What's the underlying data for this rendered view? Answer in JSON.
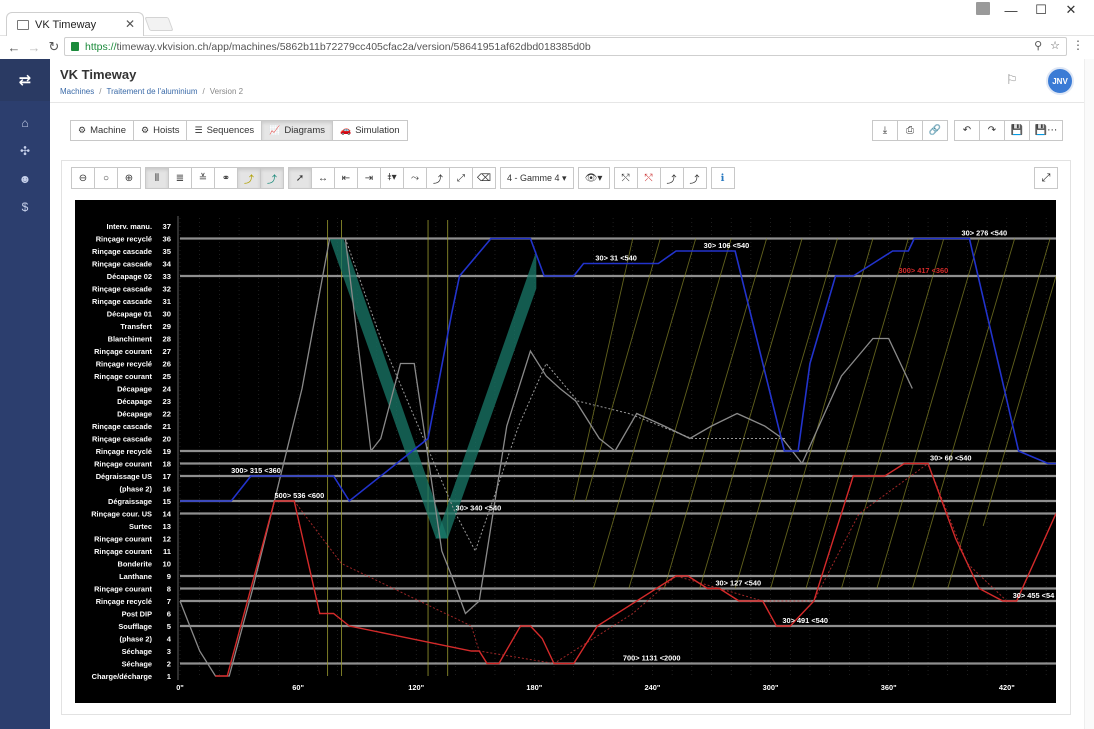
{
  "browser": {
    "tab_title": "VK Timeway",
    "url_scheme": "https://",
    "url_rest": "timeway.vkvision.ch/app/machines/5862b11b72279cc405cfac2a/version/58641951af62dbd018385d0b"
  },
  "app": {
    "title": "VK Timeway",
    "breadcrumb": [
      "Machines",
      "Traitement de l'aluminium",
      "Version 2"
    ],
    "avatar_initials": "JNV"
  },
  "tabs": [
    {
      "label": "Machine",
      "icon": "gear-icon"
    },
    {
      "label": "Hoists",
      "icon": "gear-icon"
    },
    {
      "label": "Sequences",
      "icon": "list-icon"
    },
    {
      "label": "Diagrams",
      "icon": "chart-icon",
      "active": true
    },
    {
      "label": "Simulation",
      "icon": "car-icon"
    }
  ],
  "diagram_toolbar": {
    "gamme_select": "4 - Gamme 4"
  },
  "colors": {
    "sidebar": "#2c3e6e",
    "hoist_blue": "#2233cc",
    "hoist_red": "#d42a2a",
    "hoist_grey": "#8a8a8a",
    "teal_band": "#1a7a6a",
    "yellow_lines": "#8c8c2a"
  },
  "chart_data": {
    "type": "line",
    "title": "",
    "xlabel": "",
    "ylabel": "",
    "xlim": [
      0,
      445
    ],
    "ylim": [
      1,
      37
    ],
    "x_ticks": [
      "0\"",
      "60\"",
      "120\"",
      "180\"",
      "240\"",
      "300\"",
      "360\"",
      "420\""
    ],
    "positions": [
      {
        "n": 37,
        "label": "Interv. manu."
      },
      {
        "n": 36,
        "label": "Rinçage recyclé"
      },
      {
        "n": 35,
        "label": "Rinçage cascade"
      },
      {
        "n": 34,
        "label": "Rinçage cascade"
      },
      {
        "n": 33,
        "label": "Décapage 02"
      },
      {
        "n": 32,
        "label": "Rinçage cascade"
      },
      {
        "n": 31,
        "label": "Rinçage cascade"
      },
      {
        "n": 30,
        "label": "Décapage 01"
      },
      {
        "n": 29,
        "label": "Transfert"
      },
      {
        "n": 28,
        "label": "Blanchiment"
      },
      {
        "n": 27,
        "label": "Rinçage courant"
      },
      {
        "n": 26,
        "label": "Rinçage recyclé"
      },
      {
        "n": 25,
        "label": "Rinçage courant"
      },
      {
        "n": 24,
        "label": "Décapage"
      },
      {
        "n": 23,
        "label": "Décapage"
      },
      {
        "n": 22,
        "label": "Décapage"
      },
      {
        "n": 21,
        "label": "Rinçage cascade"
      },
      {
        "n": 20,
        "label": "Rinçage cascade"
      },
      {
        "n": 19,
        "label": "Rinçage recyclé"
      },
      {
        "n": 18,
        "label": "Rinçage courant"
      },
      {
        "n": 17,
        "label": "Dégraissage US"
      },
      {
        "n": 16,
        "label": "(phase 2)"
      },
      {
        "n": 15,
        "label": "Dégraissage"
      },
      {
        "n": 14,
        "label": "Rinçage cour. US"
      },
      {
        "n": 13,
        "label": "Surtec"
      },
      {
        "n": 12,
        "label": "Rinçage courant"
      },
      {
        "n": 11,
        "label": "Rinçage courant"
      },
      {
        "n": 10,
        "label": "Bonderite"
      },
      {
        "n": 9,
        "label": "Lanthane"
      },
      {
        "n": 8,
        "label": "Rinçage courant"
      },
      {
        "n": 7,
        "label": "Rinçage recyclé"
      },
      {
        "n": 6,
        "label": "Post DIP"
      },
      {
        "n": 5,
        "label": "Soufflage"
      },
      {
        "n": 4,
        "label": "(phase 2)"
      },
      {
        "n": 3,
        "label": "Séchage"
      },
      {
        "n": 2,
        "label": "Séchage"
      },
      {
        "n": 1,
        "label": "Charge/décharge"
      }
    ],
    "annotations": [
      {
        "text": "300> 315 <360",
        "x": 26,
        "y": 17,
        "color": "#ffffff"
      },
      {
        "text": "500> 536 <600",
        "x": 48,
        "y": 15,
        "color": "#ffffff"
      },
      {
        "text": "30> 340 <540",
        "x": 140,
        "y": 14,
        "color": "#ffffff"
      },
      {
        "text": "30> 31 <540",
        "x": 211,
        "y": 34,
        "color": "#ffffff"
      },
      {
        "text": "30> 106 <540",
        "x": 266,
        "y": 35,
        "color": "#ffffff"
      },
      {
        "text": "30> 276 <540",
        "x": 397,
        "y": 36,
        "color": "#ffffff"
      },
      {
        "text": "300> 417 <360",
        "x": 365,
        "y": 33,
        "color": "#d42a2a"
      },
      {
        "text": "30> 60 <540",
        "x": 381,
        "y": 18,
        "color": "#ffffff"
      },
      {
        "text": "30> 127 <540",
        "x": 272,
        "y": 8,
        "color": "#ffffff"
      },
      {
        "text": "30> 491 <540",
        "x": 306,
        "y": 5,
        "color": "#ffffff"
      },
      {
        "text": "700> 1131 <2000",
        "x": 225,
        "y": 2,
        "color": "#ffffff"
      },
      {
        "text": "30> 455 <54",
        "x": 423,
        "y": 7,
        "color": "#ffffff"
      }
    ],
    "series": [
      {
        "hoist": "blue",
        "x": [
          0,
          12,
          17,
          20,
          26,
          31,
          36,
          55,
          69,
          78,
          86,
          126,
          132,
          138,
          142,
          158,
          178,
          185,
          190,
          200,
          205,
          210,
          238,
          243,
          252,
          263,
          268,
          276,
          282,
          307,
          314,
          320,
          333,
          342,
          352,
          362,
          370,
          373,
          390,
          396,
          401,
          426,
          441,
          445
        ],
        "y": [
          15,
          15,
          15,
          15,
          15,
          16,
          17,
          17,
          17,
          17,
          15,
          20,
          25,
          30,
          33,
          36,
          36,
          33,
          33,
          33,
          34,
          34,
          34,
          34,
          35,
          35,
          35,
          35,
          35,
          19,
          19,
          26,
          33,
          33,
          34,
          35,
          35,
          36,
          36,
          36,
          36,
          19,
          18,
          18
        ],
        "note": "approximate trace"
      }
    ],
    "horizontal_lines_at": [
      36,
      33,
      19,
      18,
      17,
      15,
      14,
      9,
      8,
      7,
      5,
      2
    ]
  }
}
